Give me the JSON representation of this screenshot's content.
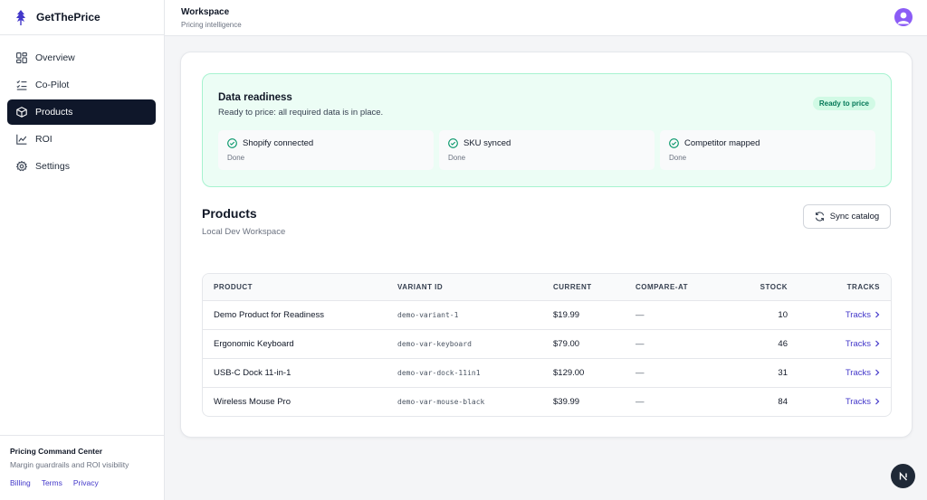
{
  "brand": {
    "name": "GetThePrice"
  },
  "nav": {
    "items": [
      {
        "label": "Overview"
      },
      {
        "label": "Co-Pilot"
      },
      {
        "label": "Products"
      },
      {
        "label": "ROI"
      },
      {
        "label": "Settings"
      }
    ],
    "active": "Products"
  },
  "sidebar_footer": {
    "title": "Pricing Command Center",
    "subtitle": "Margin guardrails and ROI visibility",
    "links": [
      "Billing",
      "Terms",
      "Privacy"
    ]
  },
  "header": {
    "title": "Workspace",
    "subtitle": "Pricing intelligence"
  },
  "readiness": {
    "title": "Data readiness",
    "subtitle": "Ready to price: all required data is in place.",
    "badge": "Ready to price",
    "checks": [
      {
        "label": "Shopify connected",
        "status": "Done"
      },
      {
        "label": "SKU synced",
        "status": "Done"
      },
      {
        "label": "Competitor mapped",
        "status": "Done"
      }
    ]
  },
  "products": {
    "title": "Products",
    "subtitle": "Local Dev Workspace",
    "sync_label": "Sync catalog",
    "columns": [
      "PRODUCT",
      "VARIANT ID",
      "CURRENT",
      "COMPARE-AT",
      "STOCK",
      "TRACKS"
    ],
    "rows": [
      {
        "product": "Demo Product for Readiness",
        "variant": "demo-variant-1",
        "current": "$19.99",
        "compare": "—",
        "stock": "10",
        "tracks": "Tracks"
      },
      {
        "product": "Ergonomic Keyboard",
        "variant": "demo-var-keyboard",
        "current": "$79.00",
        "compare": "—",
        "stock": "46",
        "tracks": "Tracks"
      },
      {
        "product": "USB-C Dock 11-in-1",
        "variant": "demo-var-dock-11in1",
        "current": "$129.00",
        "compare": "—",
        "stock": "31",
        "tracks": "Tracks"
      },
      {
        "product": "Wireless Mouse Pro",
        "variant": "demo-var-mouse-black",
        "current": "$39.99",
        "compare": "—",
        "stock": "84",
        "tracks": "Tracks"
      }
    ]
  },
  "colors": {
    "accent": "#4338ca",
    "nav_active": "#0f172a",
    "ready_bg": "#ecfdf5",
    "ready_border": "#a7f3d0",
    "avatar": "#8b5cf6"
  },
  "icons": {
    "brand": "feather-logo-icon",
    "nav": [
      "grid-icon",
      "checklist-icon",
      "box-icon",
      "line-chart-icon",
      "gear-icon"
    ],
    "check": "check-circle-icon",
    "sync": "refresh-icon",
    "tracks": "chevron-right-icon",
    "fab": "next-logo-icon"
  }
}
